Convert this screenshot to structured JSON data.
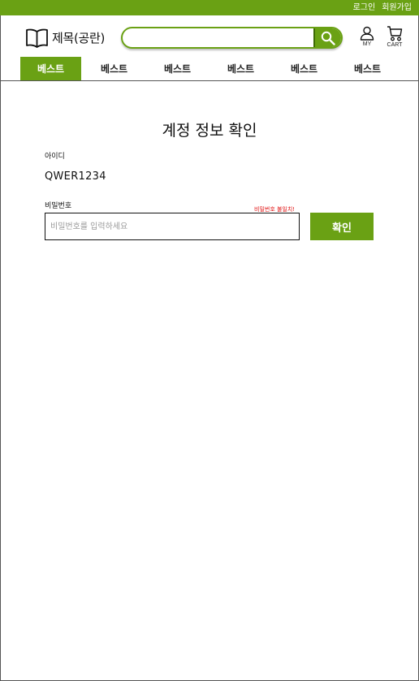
{
  "top_bar": {
    "login": "로그인",
    "signup": "회원가입"
  },
  "header": {
    "logo_icon": "open-book-icon",
    "site_title": "제목(공란)",
    "search": {
      "value": "",
      "placeholder": "",
      "icon": "search-icon"
    },
    "my_label": "MY",
    "cart_label": "CART"
  },
  "nav": {
    "tabs": [
      "베스트",
      "베스트",
      "베스트",
      "베스트",
      "베스트",
      "베스트"
    ],
    "active_index": 0
  },
  "main": {
    "title": "계정 정보 확인",
    "id_label": "아이디",
    "id_value": "QWER1234",
    "password_label": "비밀번호",
    "password_error": "비밀번호 불일치!",
    "password_placeholder": "비밀번호를 입력하세요",
    "confirm_button": "확인"
  },
  "colors": {
    "accent": "#6aa114",
    "error": "#e01010"
  }
}
